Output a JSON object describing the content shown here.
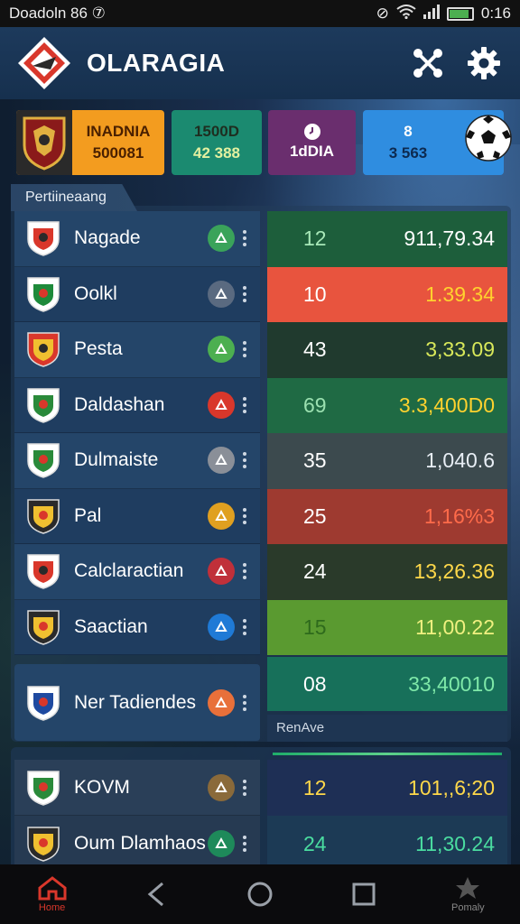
{
  "status_bar": {
    "left_text": "Doadoln 86 ⑦",
    "time": "0:16"
  },
  "app": {
    "title": "OLARAGIA"
  },
  "stats": {
    "crest_card": {
      "line1": "INADNIA",
      "line2": "500081"
    },
    "card1": {
      "line1": "1500D",
      "line2": "42 388",
      "color": "#1b8a70"
    },
    "card2": {
      "line1": "",
      "line2": "1dDIA",
      "color": "#6a2e6e"
    },
    "card3": {
      "line1": "8",
      "line2": "3 563",
      "color": "#2f8de0"
    }
  },
  "section": {
    "tab_label": "Pertiineaang",
    "footer_label": "RenAve"
  },
  "teams": [
    {
      "name": "Nagade",
      "badge_color": "#3aa35a",
      "score": "12",
      "value": "911,79.34",
      "row_color": "#1d5e3b",
      "value_color": "#ffffff",
      "score_color": "#a8e8b8"
    },
    {
      "name": "Oolkl",
      "badge_color": "#5a6a80",
      "score": "10",
      "value": "1.39.34",
      "row_color": "#e8543e",
      "value_color": "#ffd22e",
      "score_color": "#ffffff"
    },
    {
      "name": "Pesta",
      "badge_color": "#4caf50",
      "score": "43",
      "value": "3,33.09",
      "row_color": "#203a2e",
      "value_color": "#d8e85a",
      "score_color": "#ffffff"
    },
    {
      "name": "Daldashan",
      "badge_color": "#d9372b",
      "score": "69",
      "value": "3.3,400D0",
      "row_color": "#1f6a44",
      "value_color": "#ffd22e",
      "score_color": "#9be0b0"
    },
    {
      "name": "Dulmaiste",
      "badge_color": "#8a8f98",
      "score": "35",
      "value": "1,040.6",
      "row_color": "#3c4a4e",
      "value_color": "#e8eef5",
      "score_color": "#ffffff"
    },
    {
      "name": "Pal",
      "badge_color": "#e0a020",
      "score": "25",
      "value": "1,16%3",
      "row_color": "#9e3a30",
      "value_color": "#ff6b4a",
      "score_color": "#ffffff"
    },
    {
      "name": "Calclaractian",
      "badge_color": "#c0303a",
      "score": "24",
      "value": "13,26.36",
      "row_color": "#2a3a2a",
      "value_color": "#ffd84a",
      "score_color": "#ffffff"
    },
    {
      "name": "Saactian",
      "badge_color": "#1f7ad6",
      "score": "15",
      "value": "11,00.22",
      "row_color": "#5a9a30",
      "value_color": "#f0f080",
      "score_color": "#2e6a1c"
    },
    {
      "name": "Ner Tadiendes",
      "badge_color": "#e8703a",
      "score": "08",
      "value": "33,40010",
      "row_color": "#17705a",
      "value_color": "#7ee8a8",
      "score_color": "#ffffff"
    }
  ],
  "lower_teams": [
    {
      "name": "KOVM",
      "badge_color": "#8a6a3a",
      "score": "12",
      "value": "101,,6;20",
      "row_color": "#1e2f55",
      "value_color": "#ffd84a",
      "score_color": "#ffd84a"
    },
    {
      "name": "Oum Dlamhaos",
      "badge_color": "#1e8a5a",
      "score": "24",
      "value": "11,30.24",
      "row_color": "#1c3a55",
      "value_color": "#4adca0",
      "score_color": "#4adca0"
    }
  ],
  "nav": {
    "home_label": "Home",
    "profile_label": "Pomaly",
    "active_color": "#d9372b"
  }
}
